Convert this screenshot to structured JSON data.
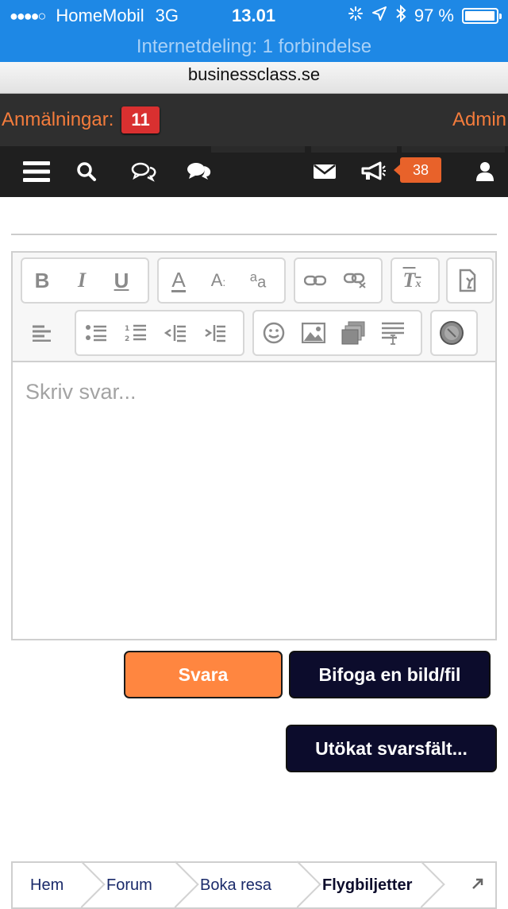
{
  "status_bar": {
    "signal": "●●●●○",
    "carrier": "HomeMobil",
    "network": "3G",
    "time": "13.01",
    "battery": "97 %"
  },
  "hotspot": "Internetdeling: 1 forbindelse",
  "url": "businessclass.se",
  "notifications": {
    "label": "Anmälningar:",
    "count": "11",
    "admin": "Admin"
  },
  "nav": {
    "alerts_count": "38"
  },
  "editor": {
    "placeholder": "Skriv svar..."
  },
  "buttons": {
    "reply": "Svara",
    "attach": "Bifoga en bild/fil",
    "expanded": "Utökat svarsfält..."
  },
  "breadcrumb": [
    "Hem",
    "Forum",
    "Boka resa",
    "Flygbiljetter"
  ],
  "colors": {
    "status_bar": "#1e88e5",
    "accent": "#f47c3c",
    "badge_red": "#d93030",
    "nav_bg": "#1f1f1f",
    "button_dark": "#0c0c2c",
    "button_orange": "#ff8640"
  }
}
